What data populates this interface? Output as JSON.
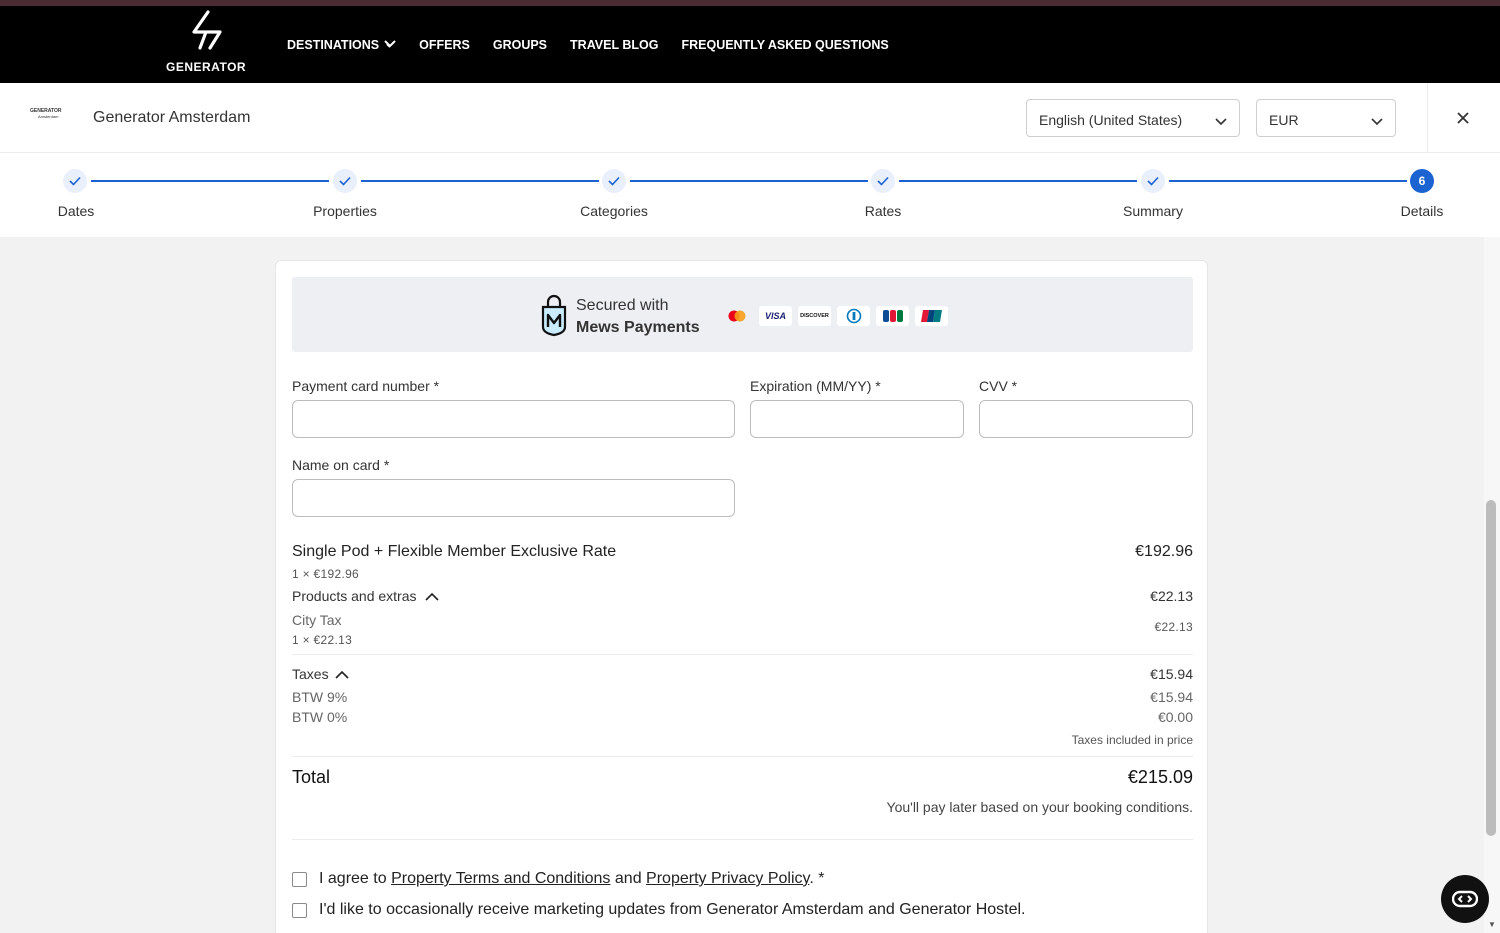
{
  "site": {
    "logo_text": "GENERATOR",
    "nav": [
      {
        "label": "DESTINATIONS"
      },
      {
        "label": "OFFERS"
      },
      {
        "label": "GROUPS"
      },
      {
        "label": "TRAVEL BLOG"
      },
      {
        "label": "FREQUENTLY ASKED QUESTIONS"
      }
    ]
  },
  "booking_header": {
    "mini_logo_line1": "GENERATOR",
    "mini_logo_line2": "Amsterdam",
    "hotel_name": "Generator Amsterdam",
    "language": "English (United States)",
    "currency": "EUR",
    "close_icon": "close-icon"
  },
  "stepper": {
    "steps": [
      {
        "label": "Dates",
        "status": "done"
      },
      {
        "label": "Properties",
        "status": "done"
      },
      {
        "label": "Categories",
        "status": "done"
      },
      {
        "label": "Rates",
        "status": "done"
      },
      {
        "label": "Summary",
        "status": "done"
      },
      {
        "label": "Details",
        "status": "active",
        "number": "6"
      }
    ],
    "accent_color": "#1c63d2"
  },
  "payment": {
    "secured_line1": "Secured with",
    "secured_line2": "Mews Payments",
    "card_brands": [
      "mastercard-icon",
      "visa-icon",
      "discover-icon",
      "diners-icon",
      "jcb-icon",
      "unionpay-icon"
    ],
    "visa_text": "VISA",
    "discover_text": "DISCOVER",
    "fields": {
      "card_number_label": "Payment card number *",
      "expiration_label": "Expiration (MM/YY) *",
      "cvv_label": "CVV *",
      "name_label": "Name on card *"
    }
  },
  "summary": {
    "item_name": "Single Pod + Flexible Member Exclusive Rate",
    "item_qty": "1 × €192.96",
    "item_price": "€192.96",
    "products_label": "Products and extras",
    "products_total": "€22.13",
    "city_tax_label": "City Tax",
    "city_tax_qty": "1 × €22.13",
    "city_tax_price": "€22.13",
    "taxes_label": "Taxes",
    "taxes_total": "€15.94",
    "btw9_label": "BTW 9%",
    "btw9_value": "€15.94",
    "btw0_label": "BTW 0%",
    "btw0_value": "€0.00",
    "taxes_note": "Taxes included in price",
    "total_label": "Total",
    "total_value": "€215.09",
    "pay_note": "You'll pay later based on your booking conditions."
  },
  "consent": {
    "agree_prefix": "I agree to",
    "terms_link": "Property Terms and Conditions",
    "and_text": "and",
    "privacy_link": "Property Privacy Policy",
    "agree_suffix": ". *",
    "marketing_text": "I'd like to occasionally receive marketing updates from Generator Amsterdam and Generator Hostel."
  }
}
